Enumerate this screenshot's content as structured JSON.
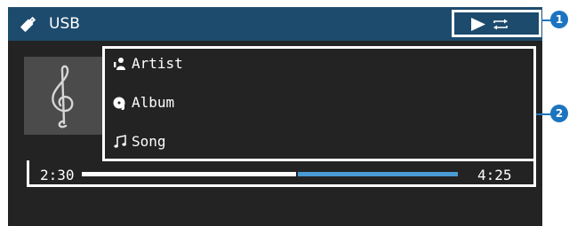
{
  "header": {
    "title": "USB",
    "icon": "usb-stick-icon",
    "status_icons": [
      "play-icon",
      "repeat-icon"
    ]
  },
  "album_art": {
    "icon": "treble-clef-icon"
  },
  "track": {
    "artist": "Artist",
    "album": "Album",
    "song": "Song",
    "elapsed": "2:30",
    "total": "4:25",
    "progress_fraction": 0.57
  },
  "callouts": [
    "1",
    "2"
  ],
  "colors": {
    "titlebar": "#1d4b6d",
    "background": "#232323",
    "progress_remaining": "#4a9ad4",
    "callout": "#1c74c0"
  }
}
